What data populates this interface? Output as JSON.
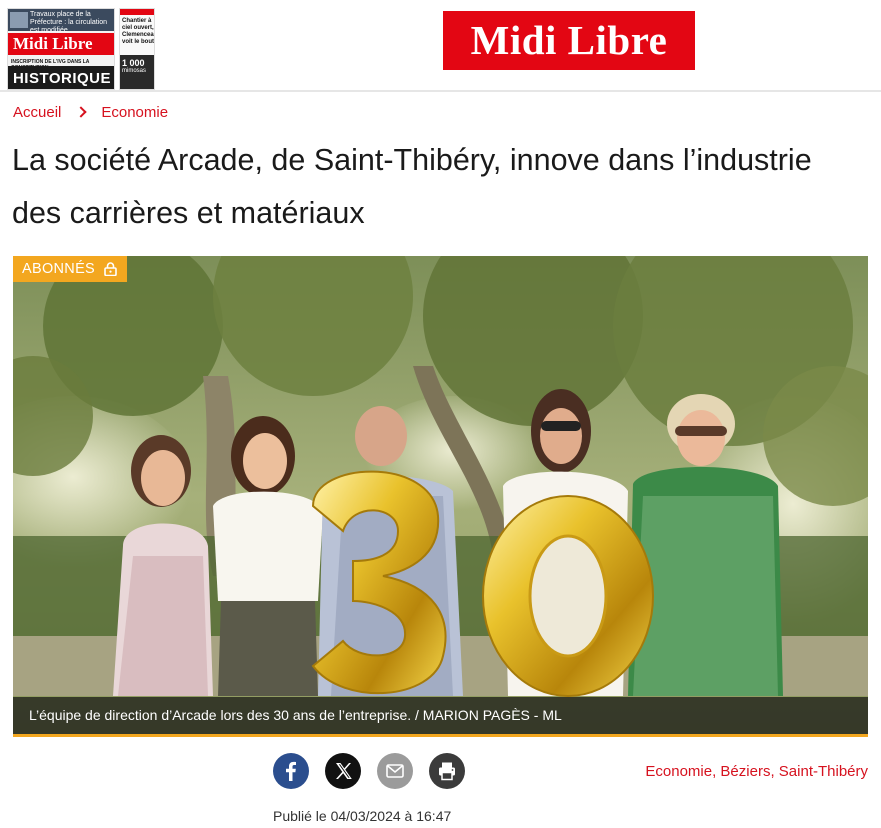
{
  "header": {
    "brand": "Midi Libre",
    "cover": {
      "top_text": "Travaux place de la Préfecture : la circulation est modifiée",
      "logo": "Midi Libre",
      "subline": "INSCRIPTION DE L'IVG DANS LA CONSTITUTION",
      "headline": "HISTORIQUE"
    },
    "side_cover": {
      "text": "Chantier à ciel ouvert, Clemenceau voit le bout",
      "dark_number": "1 000",
      "dark_text": "mimosas"
    }
  },
  "breadcrumb": {
    "home": "Accueil",
    "section": "Economie"
  },
  "article": {
    "title": "La société Arcade, de Saint-Thibéry, innove dans l’industrie des carrières et matériaux",
    "badge": "ABONNÉS",
    "caption": "L’équipe de direction d’Arcade lors des 30 ans de l’entreprise.  / MARION PAGÈS - ML",
    "published": "Publié le 04/03/2024 à 16:47"
  },
  "share": {
    "facebook": "facebook-share",
    "x": "x-share",
    "mail": "mail-share",
    "print": "print"
  },
  "tags": {
    "tag1": "Economie",
    "tag2": "Béziers",
    "tag3": "Saint-Thibéry",
    "separator": ","
  },
  "colors": {
    "brand_red": "#e30613",
    "link_red": "#d6121f",
    "subscriber_orange": "#f3a71f",
    "facebook_blue": "#2b4e8e"
  }
}
